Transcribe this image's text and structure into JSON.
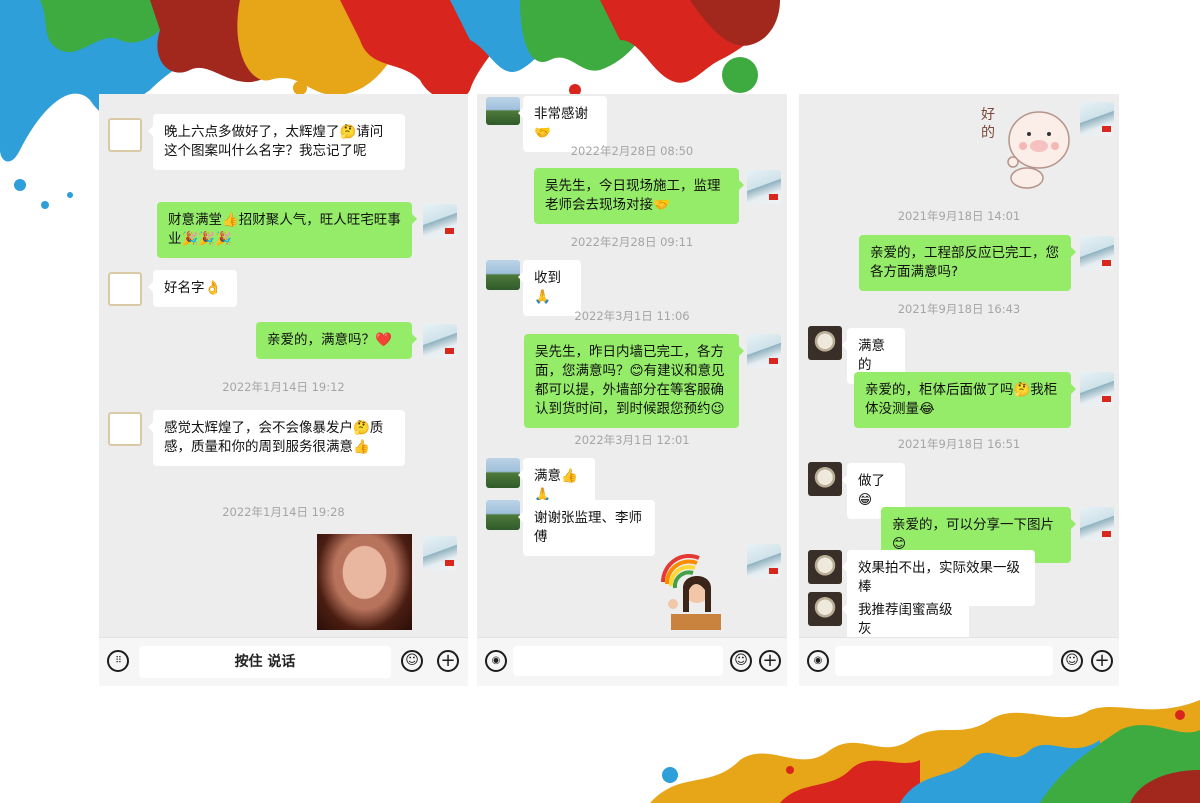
{
  "colors": {
    "bubble_out": "#95ec69",
    "bubble_in": "#ffffff",
    "panel_bg": "#ededed",
    "timestamp": "#a5a5a5"
  },
  "panel1": {
    "messages": [
      {
        "side": "in",
        "text": "晚上六点多做好了，太辉煌了🤔请问这个图案叫什么名字？我忘记了呢"
      },
      {
        "side": "out",
        "text": "财意满堂👍招财聚人气，旺人旺宅旺事业🎉🎉🎉"
      },
      {
        "side": "in",
        "text": "好名字👌"
      },
      {
        "side": "out",
        "text": "亲爱的，满意吗？❤️"
      },
      {
        "side": "in",
        "text": "感觉太辉煌了，会不会像暴发户🤔质感，质量和你的周到服务很满意👍"
      }
    ],
    "timestamps": [
      "2022年1月14日 19:12",
      "2022年1月14日 19:28"
    ],
    "talk_label": "按住 说话",
    "keyboard_icon": "keyboard-icon",
    "emoji_icon": "smiley-icon",
    "plus_icon": "plus-icon"
  },
  "panel2": {
    "messages": [
      {
        "side": "in",
        "text": "非常感谢🤝"
      },
      {
        "side": "out",
        "text": "吴先生，今日现场施工，监理老师会去现场对接🤝"
      },
      {
        "side": "in",
        "text": "收到🙏"
      },
      {
        "side": "out",
        "text": "吴先生，昨日内墙已完工，各方面，您满意吗？😊有建议和意见都可以提，外墙部分在等客服确认到货时间，到时候跟您预约😉"
      },
      {
        "side": "in",
        "text": "满意👍🙏"
      },
      {
        "side": "in",
        "text": "谢谢张监理、李师傅"
      }
    ],
    "timestamps": [
      "2022年2月28日 08:50",
      "2022年2月28日 09:11",
      "2022年3月1日 11:06",
      "2022年3月1日 12:01"
    ],
    "voice_icon": "voice-icon",
    "emoji_icon": "smiley-icon",
    "plus_icon": "plus-icon"
  },
  "panel3": {
    "sticker_text": "好的",
    "messages": [
      {
        "side": "out",
        "text": "亲爱的，工程部反应已完工，您各方面满意吗?"
      },
      {
        "side": "in",
        "text": "满意的"
      },
      {
        "side": "out",
        "text": "亲爱的，柜体后面做了吗🤔我柜体没测量😂"
      },
      {
        "side": "in",
        "text": "做了😁"
      },
      {
        "side": "out",
        "text": "亲爱的，可以分享一下图片😊"
      },
      {
        "side": "in",
        "text": "效果拍不出，实际效果一级棒"
      },
      {
        "side": "in",
        "text": "我推荐闺蜜高级灰"
      }
    ],
    "timestamps": [
      "2021年9月18日 14:01",
      "2021年9月18日 16:43",
      "2021年9月18日 16:51"
    ],
    "voice_icon": "voice-icon",
    "emoji_icon": "smiley-icon",
    "plus_icon": "plus-icon"
  }
}
